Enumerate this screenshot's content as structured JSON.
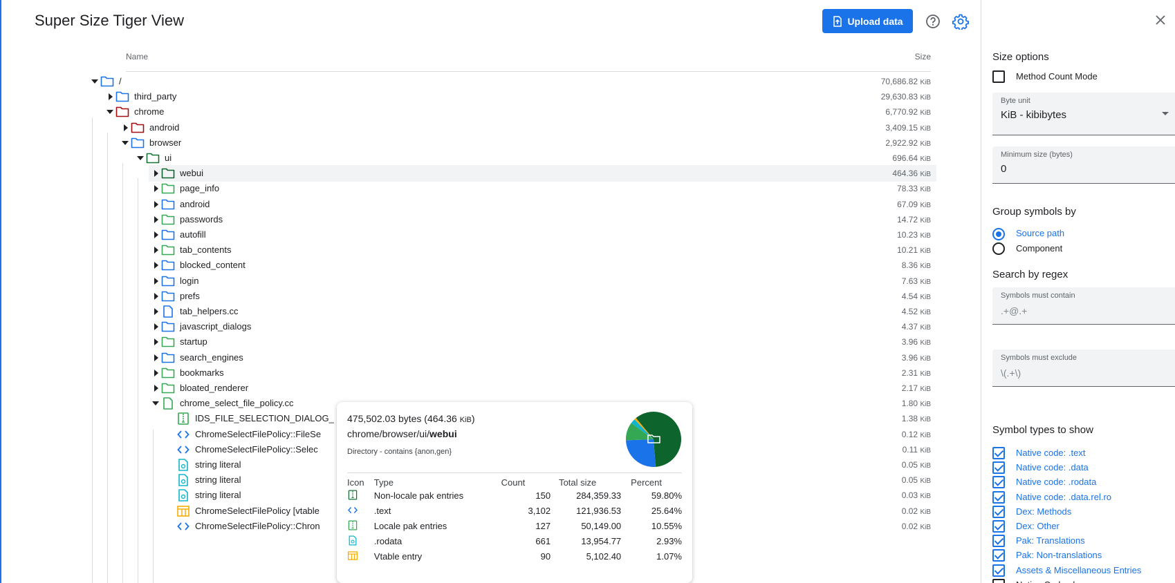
{
  "header": {
    "title": "Super Size Tiger View",
    "upload_label": "Upload data"
  },
  "tree": {
    "col_name": "Name",
    "col_size": "Size",
    "unit": "KiB",
    "rows": [
      {
        "depth": 0,
        "state": "open",
        "icon": "folder",
        "color": "#1a73e8",
        "label": "/",
        "size": "70,686.82"
      },
      {
        "depth": 1,
        "state": "closed",
        "icon": "folder",
        "color": "#1a73e8",
        "label": "third_party",
        "size": "29,630.83"
      },
      {
        "depth": 1,
        "state": "open",
        "icon": "folder",
        "color": "#a50e0e",
        "label": "chrome",
        "size": "6,770.92"
      },
      {
        "depth": 2,
        "state": "closed",
        "icon": "folder",
        "color": "#a50e0e",
        "label": "android",
        "size": "3,409.15"
      },
      {
        "depth": 2,
        "state": "open",
        "icon": "folder",
        "color": "#1a73e8",
        "label": "browser",
        "size": "2,922.92"
      },
      {
        "depth": 3,
        "state": "open",
        "icon": "folder",
        "color": "#137333",
        "label": "ui",
        "size": "696.64"
      },
      {
        "depth": 4,
        "state": "closed",
        "icon": "folder",
        "color": "#0d652d",
        "label": "webui",
        "size": "464.36",
        "highlight": true
      },
      {
        "depth": 4,
        "state": "closed",
        "icon": "folder",
        "color": "#34a853",
        "label": "page_info",
        "size": "78.33"
      },
      {
        "depth": 4,
        "state": "closed",
        "icon": "folder",
        "color": "#1a73e8",
        "label": "android",
        "size": "67.09"
      },
      {
        "depth": 4,
        "state": "closed",
        "icon": "folder",
        "color": "#34a853",
        "label": "passwords",
        "size": "14.72"
      },
      {
        "depth": 4,
        "state": "closed",
        "icon": "folder",
        "color": "#1a73e8",
        "label": "autofill",
        "size": "10.23"
      },
      {
        "depth": 4,
        "state": "closed",
        "icon": "folder",
        "color": "#34a853",
        "label": "tab_contents",
        "size": "10.21"
      },
      {
        "depth": 4,
        "state": "closed",
        "icon": "folder",
        "color": "#1a73e8",
        "label": "blocked_content",
        "size": "8.36"
      },
      {
        "depth": 4,
        "state": "closed",
        "icon": "folder",
        "color": "#1a73e8",
        "label": "login",
        "size": "7.63"
      },
      {
        "depth": 4,
        "state": "closed",
        "icon": "folder",
        "color": "#1a73e8",
        "label": "prefs",
        "size": "4.54"
      },
      {
        "depth": 4,
        "state": "closed",
        "icon": "file",
        "color": "#1a73e8",
        "label": "tab_helpers.cc",
        "size": "4.52"
      },
      {
        "depth": 4,
        "state": "closed",
        "icon": "folder",
        "color": "#1a73e8",
        "label": "javascript_dialogs",
        "size": "4.37"
      },
      {
        "depth": 4,
        "state": "closed",
        "icon": "folder",
        "color": "#34a853",
        "label": "startup",
        "size": "3.96"
      },
      {
        "depth": 4,
        "state": "closed",
        "icon": "folder",
        "color": "#1a73e8",
        "label": "search_engines",
        "size": "3.96"
      },
      {
        "depth": 4,
        "state": "closed",
        "icon": "folder",
        "color": "#34a853",
        "label": "bookmarks",
        "size": "2.31"
      },
      {
        "depth": 4,
        "state": "closed",
        "icon": "folder",
        "color": "#34a853",
        "label": "bloated_renderer",
        "size": "2.17"
      },
      {
        "depth": 4,
        "state": "open",
        "icon": "file",
        "color": "#34a853",
        "label": "chrome_select_file_policy.cc",
        "size": "1.80"
      },
      {
        "depth": 5,
        "state": "none",
        "icon": "pak",
        "color": "#34a853",
        "label": "IDS_FILE_SELECTION_DIALOG_",
        "size": "1.38"
      },
      {
        "depth": 5,
        "state": "none",
        "icon": "code",
        "color": "#1a73e8",
        "label": "ChromeSelectFilePolicy::FileSe",
        "size": "0.12"
      },
      {
        "depth": 5,
        "state": "none",
        "icon": "code",
        "color": "#1a73e8",
        "label": "ChromeSelectFilePolicy::Selec",
        "size": "0.11"
      },
      {
        "depth": 5,
        "state": "none",
        "icon": "string",
        "color": "#12b5cb",
        "label": "string literal",
        "size": "0.05"
      },
      {
        "depth": 5,
        "state": "none",
        "icon": "string",
        "color": "#12b5cb",
        "label": "string literal",
        "size": "0.05"
      },
      {
        "depth": 5,
        "state": "none",
        "icon": "string",
        "color": "#12b5cb",
        "label": "string literal",
        "size": "0.03"
      },
      {
        "depth": 5,
        "state": "none",
        "icon": "vtable",
        "color": "#f9ab00",
        "label": "ChromeSelectFilePolicy [vtable",
        "size": "0.02"
      },
      {
        "depth": 5,
        "state": "none",
        "icon": "code",
        "color": "#1a73e8",
        "label": "ChromeSelectFilePolicy::Chron",
        "size": "0.02"
      }
    ]
  },
  "tooltip": {
    "bytes": "475,502.03 bytes (464.36",
    "bytes_unit": "KiB",
    "bytes_close": ")",
    "path_prefix": "chrome/browser/ui/",
    "path_bold": "webui",
    "description": "Directory - contains {anon,gen}",
    "headers": {
      "icon": "Icon",
      "type": "Type",
      "count": "Count",
      "total": "Total size",
      "percent": "Percent"
    },
    "rows": [
      {
        "icon": "pak",
        "color": "#137333",
        "type": "Non-locale pak entries",
        "count": "150",
        "total": "284,359.33",
        "percent": "59.80%"
      },
      {
        "icon": "code",
        "color": "#1a73e8",
        "type": ".text",
        "count": "3,102",
        "total": "121,936.53",
        "percent": "25.64%"
      },
      {
        "icon": "pak",
        "color": "#34a853",
        "type": "Locale pak entries",
        "count": "127",
        "total": "50,149.00",
        "percent": "10.55%"
      },
      {
        "icon": "string",
        "color": "#12b5cb",
        "type": ".rodata",
        "count": "661",
        "total": "13,954.77",
        "percent": "2.93%"
      },
      {
        "icon": "vtable",
        "color": "#f9ab00",
        "type": "Vtable entry",
        "count": "90",
        "total": "5,102.40",
        "percent": "1.07%"
      }
    ],
    "pie": [
      {
        "value": 59.8,
        "color": "#0d652d"
      },
      {
        "value": 25.64,
        "color": "#1a73e8"
      },
      {
        "value": 10.55,
        "color": "#34a853"
      },
      {
        "value": 2.93,
        "color": "#12b5cb"
      },
      {
        "value": 1.07,
        "color": "#f9ab00"
      }
    ]
  },
  "panel": {
    "size_options": "Size options",
    "method_count_mode": "Method Count Mode",
    "byte_unit_label": "Byte unit",
    "byte_unit_value": "KiB - kibibytes",
    "min_size_label": "Minimum size (bytes)",
    "min_size_value": "0",
    "group_by": "Group symbols by",
    "source_path": "Source path",
    "component": "Component",
    "search_regex": "Search by regex",
    "must_contain_label": "Symbols must contain",
    "must_contain_placeholder": ".+@.+",
    "must_exclude_label": "Symbols must exclude",
    "must_exclude_placeholder": "\\(.+\\)",
    "symbol_types": "Symbol types to show",
    "types": [
      {
        "label": "Native code: .text",
        "checked": true
      },
      {
        "label": "Native code: .data",
        "checked": true
      },
      {
        "label": "Native code: .rodata",
        "checked": true
      },
      {
        "label": "Native code: .data.rel.ro",
        "checked": true
      },
      {
        "label": "Dex: Methods",
        "checked": true
      },
      {
        "label": "Dex: Other",
        "checked": true
      },
      {
        "label": "Pak: Translations",
        "checked": true
      },
      {
        "label": "Pak: Non-translations",
        "checked": true
      },
      {
        "label": "Assets & Miscellaneous Entries",
        "checked": true
      },
      {
        "label": "Native Code: .bss",
        "checked": false
      }
    ]
  }
}
